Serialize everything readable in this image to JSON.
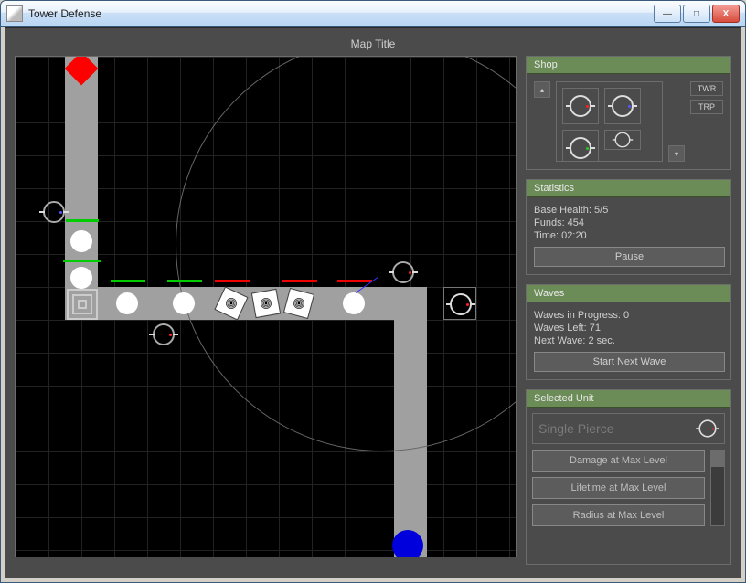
{
  "window": {
    "title": "Tower Defense"
  },
  "map_title": "Map Title",
  "shop": {
    "header": "Shop",
    "tabs": {
      "twr": "TWR",
      "trp": "TRP"
    }
  },
  "statistics": {
    "header": "Statistics",
    "base_health_label": "Base Health: 5/5",
    "funds_label": "Funds: 454",
    "time_label": "Time: 02:20",
    "pause_label": "Pause"
  },
  "waves": {
    "header": "Waves",
    "in_progress_label": "Waves in Progress: 0",
    "left_label": "Waves Left: 71",
    "next_label": "Next Wave: 2 sec.",
    "start_label": "Start Next Wave"
  },
  "selected_unit": {
    "header": "Selected Unit",
    "name": "Single Pierce",
    "btn_damage": "Damage at Max Level",
    "btn_lifetime": "Lifetime at Max Level",
    "btn_radius": "Radius at Max Level"
  }
}
